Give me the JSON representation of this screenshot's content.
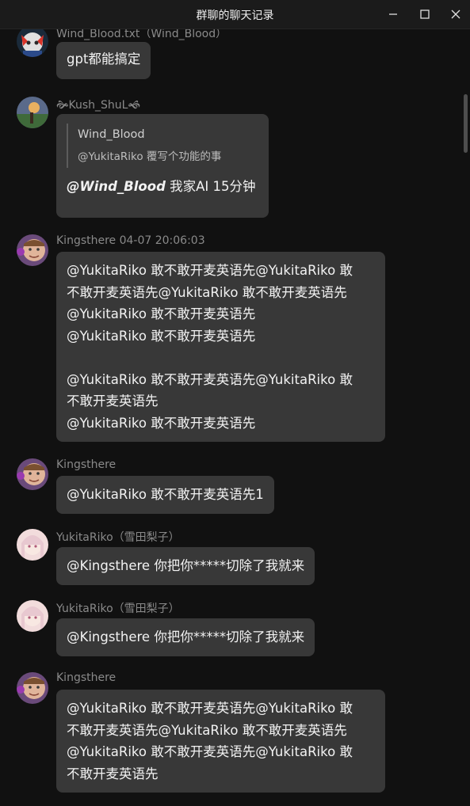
{
  "window": {
    "title": "群聊的聊天记录"
  },
  "messages": [
    {
      "sender": "Wind_Blood.txt（Wind_Blood）",
      "lines": [
        "gpt都能搞定"
      ]
    },
    {
      "sender": "🙞Kush_ShuL🙜",
      "quote": {
        "name": "Wind_Blood",
        "text": "@YukitaRiko 覆写个功能的事"
      },
      "reply_mention": "@Wind_Blood",
      "reply_text": " 我家AI 15分钟"
    },
    {
      "sender": "Kingsthere 04-07 20:06:03",
      "lines": [
        "@YukitaRiko 敢不敢开麦英语先@YukitaRiko 敢",
        "不敢开麦英语先@YukitaRiko 敢不敢开麦英语先",
        "@YukitaRiko 敢不敢开麦英语先",
        "@YukitaRiko 敢不敢开麦英语先",
        "",
        "@YukitaRiko 敢不敢开麦英语先@YukitaRiko 敢",
        "不敢开麦英语先",
        "@YukitaRiko 敢不敢开麦英语先"
      ]
    },
    {
      "sender": "Kingsthere",
      "lines": [
        "@YukitaRiko 敢不敢开麦英语先1"
      ]
    },
    {
      "sender": "YukitaRiko（雪田梨子）",
      "lines": [
        "@Kingsthere 你把你*****切除了我就来"
      ]
    },
    {
      "sender": "YukitaRiko（雪田梨子）",
      "lines": [
        "@Kingsthere 你把你*****切除了我就来"
      ]
    },
    {
      "sender": "Kingsthere",
      "lines": [
        "@YukitaRiko 敢不敢开麦英语先@YukitaRiko 敢",
        "不敢开麦英语先@YukitaRiko 敢不敢开麦英语先",
        "@YukitaRiko 敢不敢开麦英语先@YukitaRiko 敢",
        "不敢开麦英语先"
      ]
    }
  ]
}
